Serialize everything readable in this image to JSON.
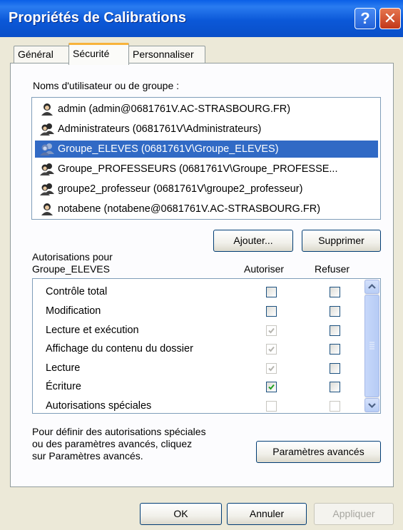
{
  "window": {
    "title": "Propriétés de Calibrations",
    "help_icon": "help-icon",
    "close_icon": "close-icon"
  },
  "tabs": [
    {
      "label": "Général",
      "active": false
    },
    {
      "label": "Sécurité",
      "active": true
    },
    {
      "label": "Personnaliser",
      "active": false
    }
  ],
  "users": {
    "label": "Noms d'utilisateur ou de groupe :",
    "items": [
      {
        "name": "admin (admin@0681761V.AC-STRASBOURG.FR)",
        "icon": "user-icon",
        "selected": false
      },
      {
        "name": "Administrateurs (0681761V\\Administrateurs)",
        "icon": "group-icon",
        "selected": false
      },
      {
        "name": "Groupe_ELEVES (0681761V\\Groupe_ELEVES)",
        "icon": "group-icon",
        "selected": true
      },
      {
        "name": "Groupe_PROFESSEURS (0681761V\\Groupe_PROFESSE...",
        "icon": "group-icon",
        "selected": false
      },
      {
        "name": "groupe2_professeur (0681761V\\groupe2_professeur)",
        "icon": "group-icon",
        "selected": false
      },
      {
        "name": "notabene (notabene@0681761V.AC-STRASBOURG.FR)",
        "icon": "user-icon",
        "selected": false
      }
    ],
    "add_button": "Ajouter...",
    "remove_button": "Supprimer"
  },
  "permissions": {
    "label_line1": "Autorisations pour",
    "label_line2": "Groupe_ELEVES",
    "allow_header": "Autoriser",
    "deny_header": "Refuser",
    "rows": [
      {
        "name": "Contrôle total",
        "allow": "unchecked",
        "deny": "unchecked"
      },
      {
        "name": "Modification",
        "allow": "unchecked",
        "deny": "unchecked"
      },
      {
        "name": "Lecture et exécution",
        "allow": "checked-disabled",
        "deny": "unchecked"
      },
      {
        "name": "Affichage du contenu du dossier",
        "allow": "checked-disabled",
        "deny": "unchecked"
      },
      {
        "name": "Lecture",
        "allow": "checked-disabled",
        "deny": "unchecked"
      },
      {
        "name": "Écriture",
        "allow": "checked",
        "deny": "unchecked"
      },
      {
        "name": "Autorisations spéciales",
        "allow": "disabled",
        "deny": "disabled"
      }
    ]
  },
  "advanced": {
    "line1": "Pour définir des autorisations spéciales",
    "line2": "ou des paramètres avancés, cliquez",
    "line3": "sur Paramètres avancés.",
    "button": "Paramètres avancés"
  },
  "footer": {
    "ok": "OK",
    "cancel": "Annuler",
    "apply": "Appliquer"
  },
  "colors": {
    "titlebar": "#0a5fe6",
    "selection": "#316ac5",
    "check_green": "#21a121",
    "dialog_bg": "#ece9d8"
  }
}
